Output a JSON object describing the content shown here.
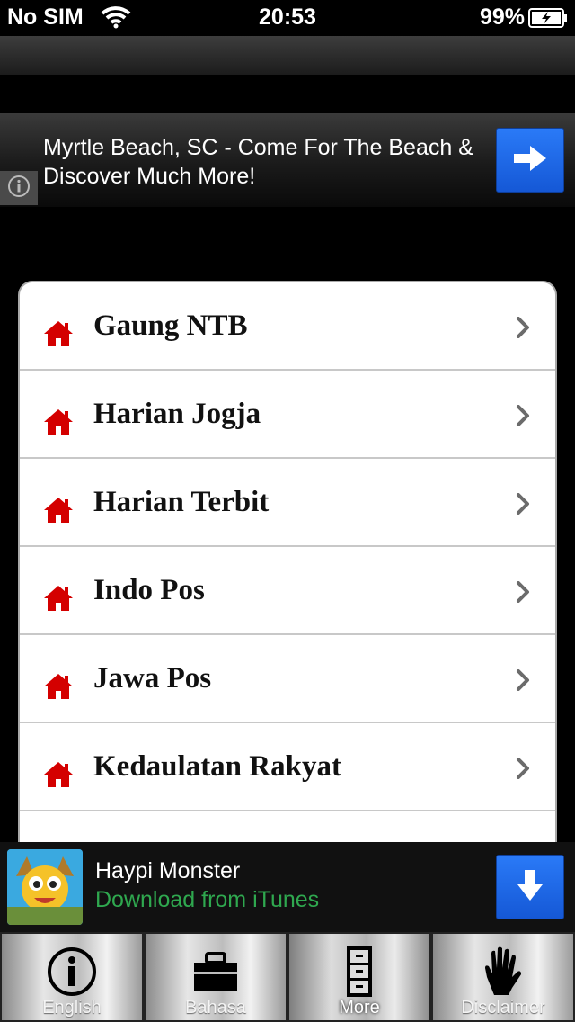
{
  "status_bar": {
    "carrier": "No SIM",
    "time": "20:53",
    "battery": "99%"
  },
  "ad_banner": {
    "text": "Myrtle Beach, SC - Come For The Beach & Discover Much More!",
    "go_icon": "arrow-right-icon",
    "info_icon": "info-icon"
  },
  "list": {
    "items": [
      {
        "label": "Gaung NTB",
        "icon": "house-icon"
      },
      {
        "label": "Harian Jogja",
        "icon": "house-icon"
      },
      {
        "label": "Harian Terbit",
        "icon": "house-icon"
      },
      {
        "label": "Indo Pos",
        "icon": "house-icon"
      },
      {
        "label": "Jawa Pos",
        "icon": "house-icon"
      },
      {
        "label": "Kedaulatan Rakyat",
        "icon": "house-icon"
      }
    ]
  },
  "app_ad": {
    "name": "Haypi Monster",
    "subtitle": "Download from iTunes",
    "button_icon": "arrow-down-icon"
  },
  "tab_bar": {
    "tabs": [
      {
        "label": "English",
        "icon": "info-circle-icon"
      },
      {
        "label": "Bahasa",
        "icon": "briefcase-icon"
      },
      {
        "label": "More",
        "icon": "cabinet-icon",
        "active": true
      },
      {
        "label": "Disclaimer",
        "icon": "hand-icon"
      }
    ]
  },
  "colors": {
    "accent_blue": "#1f6be8",
    "house_red": "#d40000",
    "itunes_green": "#2fa84f"
  }
}
